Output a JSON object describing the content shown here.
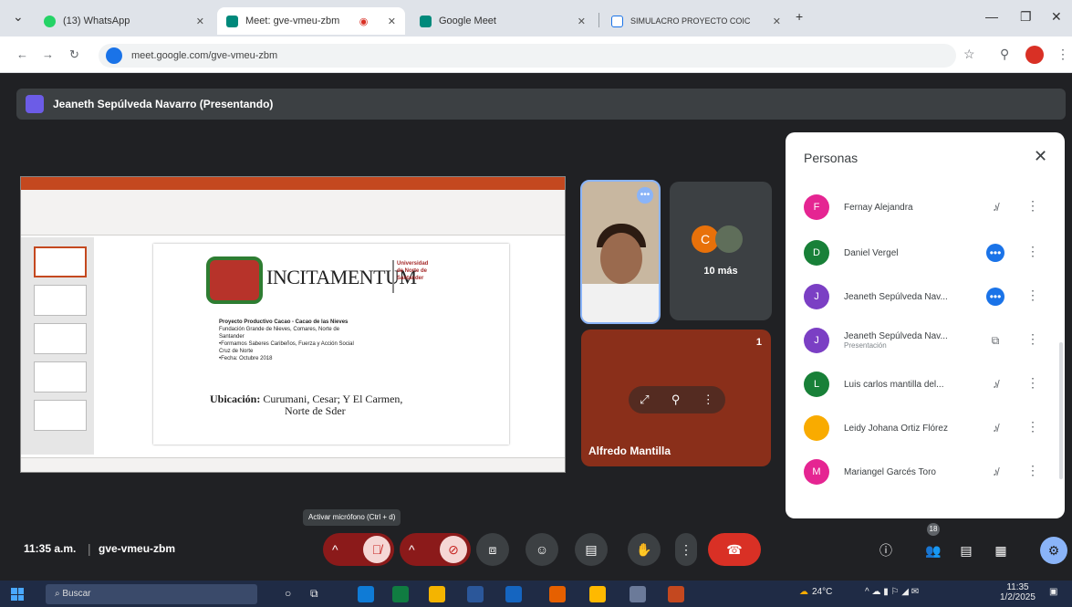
{
  "browser": {
    "tabs": [
      {
        "title": "(13) WhatsApp",
        "color": "#25d366",
        "active": false
      },
      {
        "title": "Meet: gve-vmeu-zbm",
        "color": "#00897b",
        "active": true
      },
      {
        "title": "Google Meet",
        "color": "#00897b",
        "active": false
      },
      {
        "title": "SIMULACRO PROYECTO COIC",
        "color": "#1a73e8",
        "active": false
      }
    ],
    "new_tab": "+",
    "url": "meet.google.com/gve-vmeu-zbm"
  },
  "meet": {
    "presenter_label": "Jeaneth Sepúlveda Navarro (Presentando)",
    "slide": {
      "logo_text": "INCITAMENTUM",
      "university_text": "Universidad de Norte de Santander",
      "project_lines": [
        "Proyecto Productivo Cacao - Cacao de las Nieves",
        "Fundación Grande de Nieves, Comares, Norte de",
        "Santander",
        "•Formamos Saberes Caribeños, Fuerza y Acción Social",
        "Cruz de Norte",
        "•Fecha: Octubre 2018"
      ],
      "ubicacion_label": "Ubicación:",
      "ubicacion_text": "Curumani, Cesar; Y El Carmen,",
      "ubicacion_line2": "Norte de Sder"
    },
    "tiles": {
      "more_label": "10 más",
      "more_initial": "C",
      "alfredo_name": "Alfredo Mantilla",
      "alfredo_count": "1"
    },
    "people_panel": {
      "title": "Personas",
      "people": [
        {
          "name": "Fernay Alejandra",
          "initial": "F",
          "color": "#e52592",
          "mic": "muted"
        },
        {
          "name": "Daniel Vergel",
          "initial": "D",
          "color": "#188038",
          "mic": "live"
        },
        {
          "name": "Jeaneth Sepúlveda Nav...",
          "initial": "J",
          "color": "#7b3fc4",
          "mic": "live"
        },
        {
          "name": "Jeaneth Sepúlveda Nav...",
          "subtitle": "Presentación",
          "initial": "J",
          "color": "#7b3fc4",
          "mic": "present"
        },
        {
          "name": "Luis carlos mantilla del...",
          "initial": "L",
          "color": "#188038",
          "mic": "muted"
        },
        {
          "name": "Leidy Johana Ortiz Flórez",
          "initial": "",
          "color": "#f9ab00",
          "mic": "muted"
        },
        {
          "name": "Mariangel Garcés Toro",
          "initial": "M",
          "color": "#e52592",
          "mic": "muted"
        }
      ]
    },
    "toolbar": {
      "tooltip": "Activar micrófono (Ctrl + d)",
      "time": "11:35 a.m.",
      "meeting_code": "gve-vmeu-zbm",
      "participant_count": "18"
    }
  },
  "taskbar": {
    "search_placeholder": "Buscar",
    "weather": "24°C",
    "time": "11:35",
    "date": "1/2/2025"
  },
  "colors": {
    "meet_bg": "#202124",
    "end_call": "#d93025",
    "mic_off_group": "#8b1a1a",
    "accent": "#8ab4f8"
  }
}
